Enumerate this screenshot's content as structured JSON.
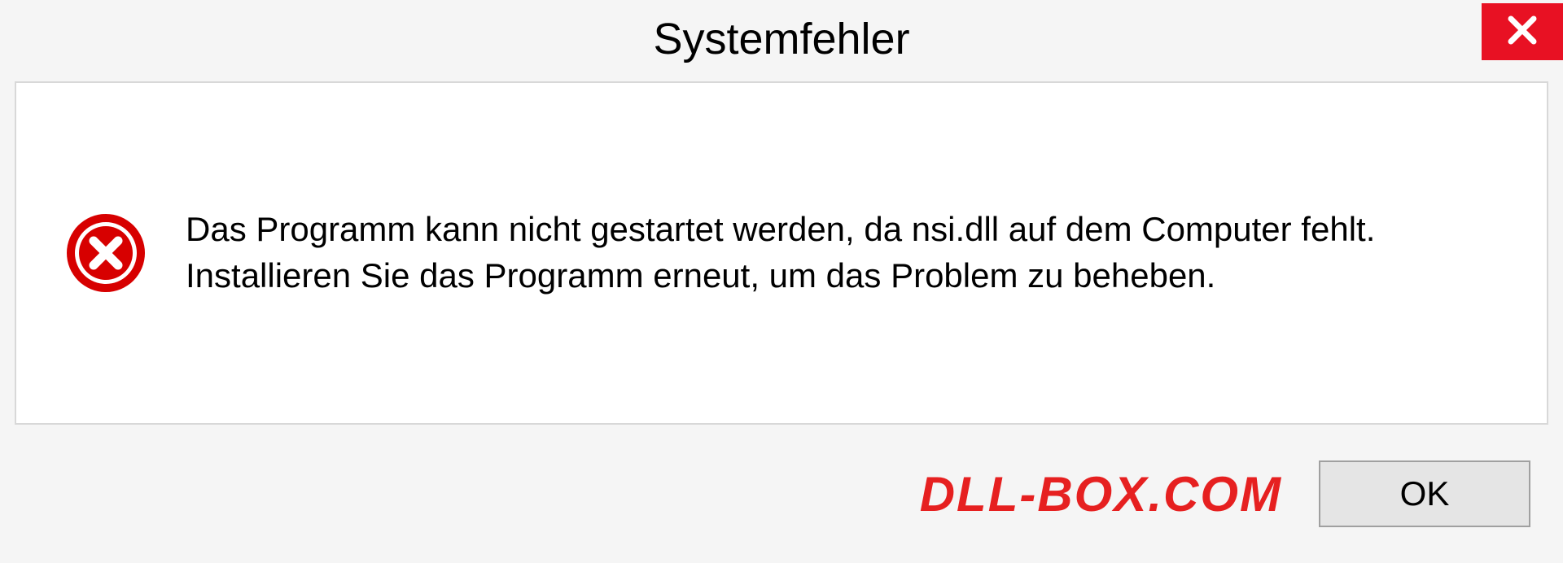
{
  "dialog": {
    "title": "Systemfehler",
    "message": "Das Programm kann nicht gestartet werden, da nsi.dll auf dem Computer fehlt. Installieren Sie das Programm erneut, um das Problem zu beheben.",
    "ok_label": "OK"
  },
  "watermark": "DLL-BOX.COM"
}
